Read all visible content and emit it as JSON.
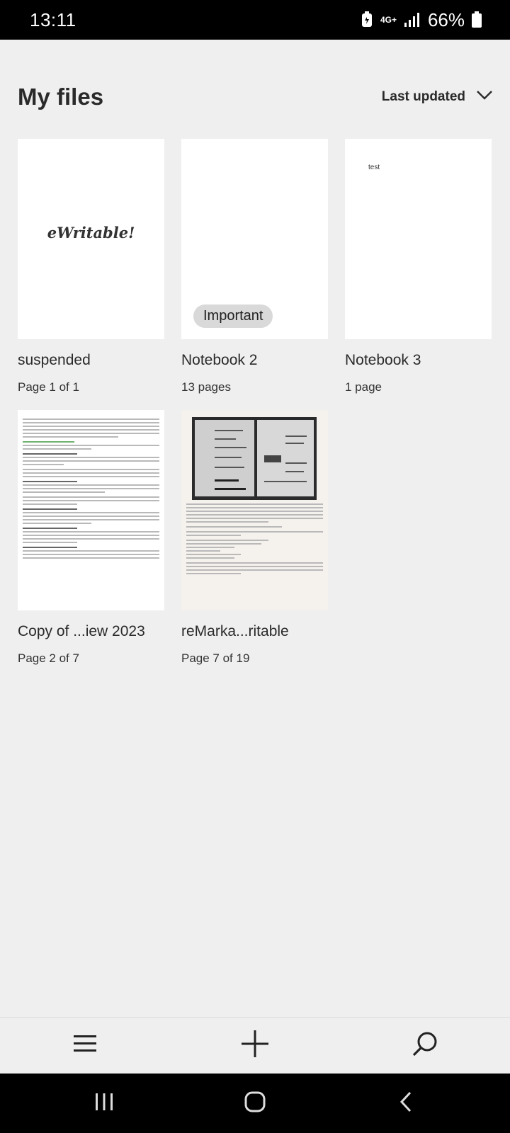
{
  "status_bar": {
    "time": "13:11",
    "network": "4G+",
    "battery": "66%"
  },
  "header": {
    "title": "My files",
    "sort_label": "Last updated"
  },
  "files": [
    {
      "name": "suspended",
      "meta": "Page 1 of 1",
      "thumb_text": "eWritable!"
    },
    {
      "name": "Notebook 2",
      "meta": "13 pages",
      "tag": "Important"
    },
    {
      "name": "Notebook 3",
      "meta": "1 page",
      "thumb_text": "test"
    },
    {
      "name": "Copy of ...iew 2023",
      "meta": "Page 2 of 7"
    },
    {
      "name": "reMarka...ritable",
      "meta": "Page 7 of 19"
    }
  ],
  "toolbar": {
    "menu_icon": "menu-icon",
    "add_icon": "plus-icon",
    "search_icon": "search-icon"
  },
  "navbar": {
    "recents": "recent-apps-icon",
    "home": "home-icon",
    "back": "back-icon"
  }
}
